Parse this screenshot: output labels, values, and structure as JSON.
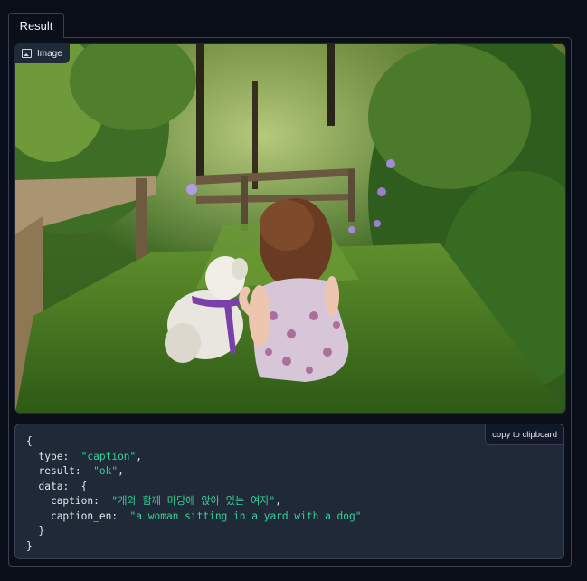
{
  "tab": {
    "label": "Result"
  },
  "image": {
    "label": "Image",
    "label_icon": "image-icon",
    "alt": "a girl sitting with a dog"
  },
  "code": {
    "copy_label": "copy to clipboard",
    "type_key": "type",
    "type_value": "\"caption\"",
    "result_key": "result",
    "result_value": "\"ok\"",
    "data_key": "data",
    "caption_key": "caption",
    "caption_value": "\"개와 함께 마당에 앉아 있는 여자\"",
    "caption_en_key": "caption_en",
    "caption_en_value": "\"a woman sitting in a yard with a dog\""
  },
  "colors": {
    "background": "#0b0f19",
    "panel_border": "#374151",
    "code_bg": "#1f2937",
    "string": "#34d399"
  }
}
